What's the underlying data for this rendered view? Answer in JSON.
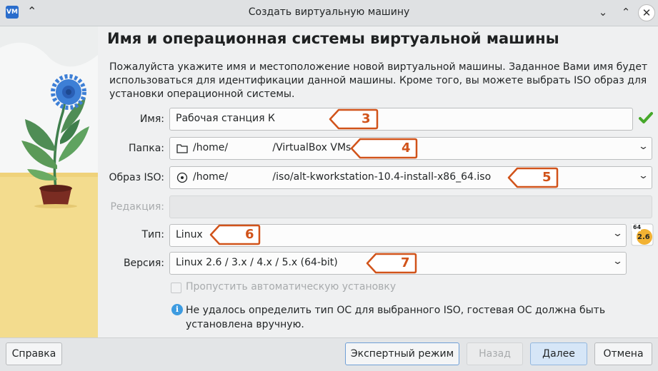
{
  "window": {
    "title": "Создать виртуальную машину",
    "app_icon_text": "VM",
    "collapse_glyph": "⌃",
    "min_glyph": "⌄",
    "max_glyph": "⌃",
    "close_glyph": "✕"
  },
  "page": {
    "heading": "Имя и операционная системы виртуальной машины",
    "description": "Пожалуйста укажите имя и местоположение новой виртуальной машины. Заданное Вами имя будет использоваться для идентификации данной машины. Кроме того, вы можете выбрать ISO образ для установки операционной системы."
  },
  "form": {
    "name": {
      "label": "Имя:",
      "value": "Рабочая станция К",
      "status_icon": "check-icon"
    },
    "folder": {
      "label": "Папка:",
      "value": "/home/              /VirtualBox VMs",
      "icon": "folder-icon"
    },
    "iso": {
      "label": "Образ ISO:",
      "value": "/home/              /iso/alt-kworkstation-10.4-install-x86_64.iso",
      "icon": "disc-icon"
    },
    "edition": {
      "label": "Редакция:",
      "value": ""
    },
    "type": {
      "label": "Тип:",
      "value": "Linux",
      "badge_top": "64",
      "badge_bottom": "2.6"
    },
    "version": {
      "label": "Версия:",
      "value": "Linux 2.6 / 3.x / 4.x / 5.x (64-bit)"
    },
    "skip_unattended": {
      "label": "Пропустить автоматическую установку",
      "checked": false
    },
    "info": {
      "icon": "info-icon",
      "glyph": "i",
      "text": "Не удалось определить тип ОС для выбранного ISO, гостевая ОС должна быть установлена вручную."
    }
  },
  "callouts": [
    "3",
    "4",
    "5",
    "6",
    "7"
  ],
  "buttons": {
    "help": "Справка",
    "expert": "Экспертный режим",
    "back": "Назад",
    "next": "Далее",
    "cancel": "Отмена"
  },
  "colors": {
    "callout": "#d1531a",
    "accent": "#3d9be0",
    "ok_green": "#46a82a"
  }
}
